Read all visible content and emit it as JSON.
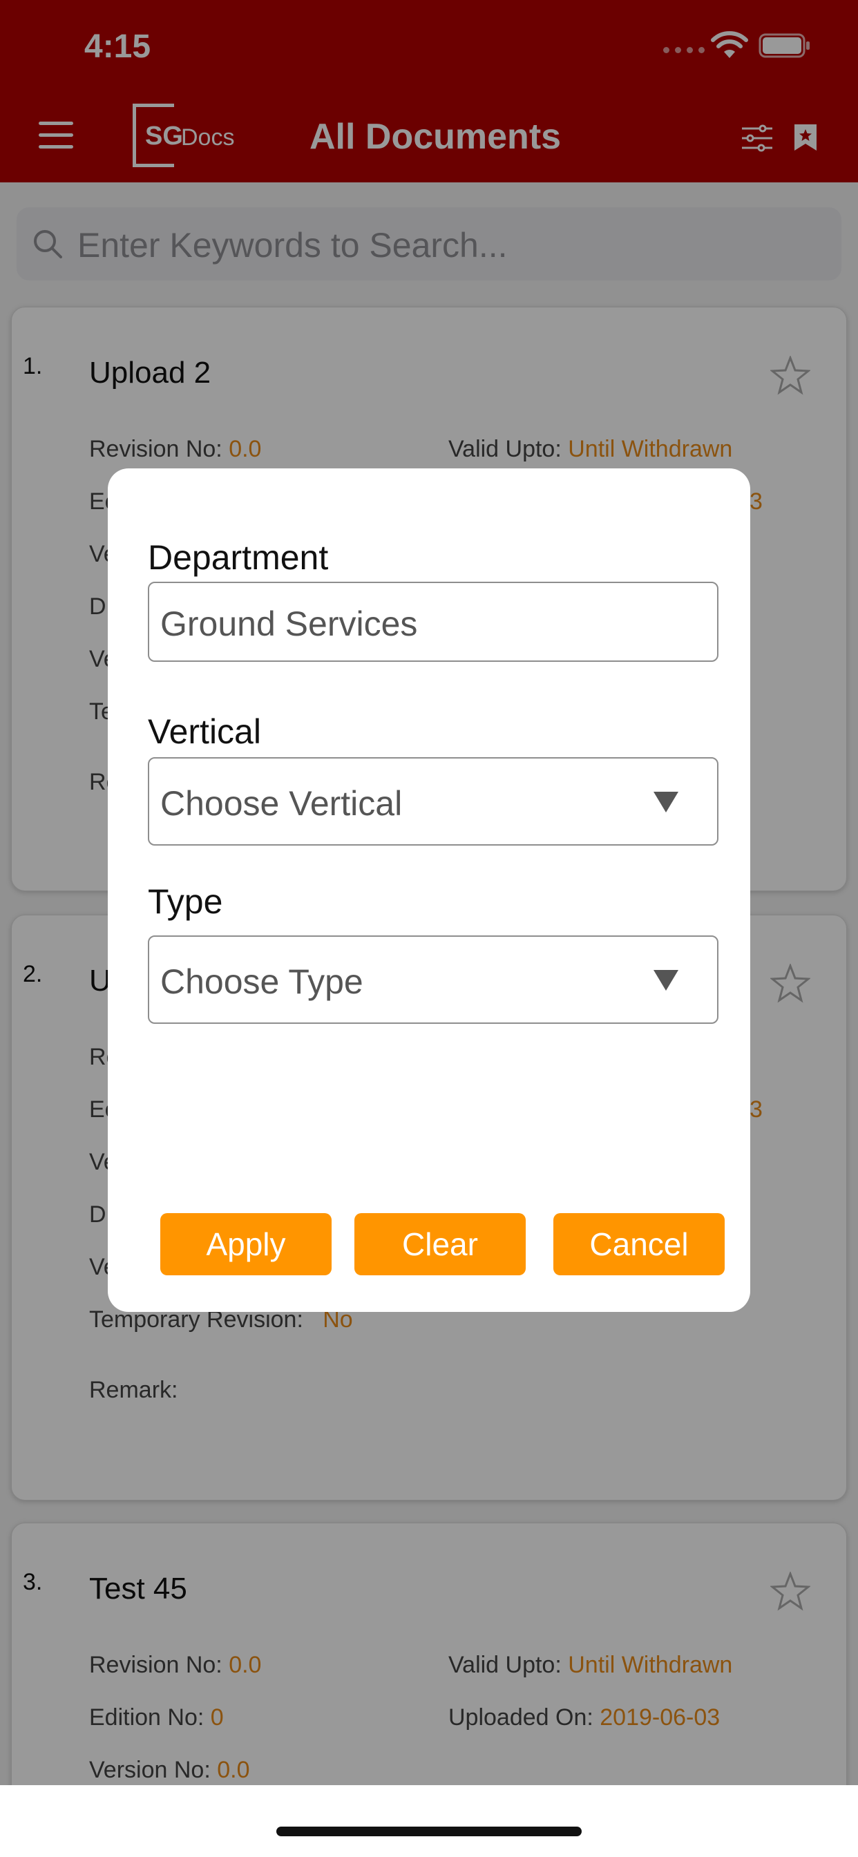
{
  "status_bar": {
    "time": "4:15"
  },
  "header": {
    "logo_mark": "SG",
    "logo_text": "Docs",
    "title": "All Documents"
  },
  "search": {
    "placeholder": "Enter Keywords to Search..."
  },
  "documents": [
    {
      "number": "1.",
      "title": "Upload 2",
      "revision_label": "Revision No:",
      "revision": "0.0",
      "valid_label": "Valid Upto:",
      "valid": "Until Withdrawn",
      "edition_partial": "Ec",
      "uploaded_partial": "3",
      "row3_partial": "Ve",
      "row4_partial": "D",
      "row5_partial": "Ve",
      "row6_partial": "Te",
      "remark_partial": "Re"
    },
    {
      "number": "2.",
      "title_partial": "U",
      "revision_partial": "Re",
      "edition_partial": "Ec",
      "uploaded_partial": "3",
      "row3_partial": "Ve",
      "row4_partial": "D",
      "row5_partial": "Ve",
      "temp_label": "Temporary Revision:",
      "temp": "No",
      "remark_label": "Remark:"
    },
    {
      "number": "3.",
      "title": "Test 45",
      "revision_label": "Revision No:",
      "revision": "0.0",
      "valid_label": "Valid Upto:",
      "valid": "Until Withdrawn",
      "edition_label": "Edition No:",
      "edition": "0",
      "uploaded_label": "Uploaded On:",
      "uploaded": "2019-06-03",
      "version_label": "Version No:",
      "version": "0.0"
    }
  ],
  "filter_dialog": {
    "department_label": "Department",
    "department_value": "Ground Services",
    "vertical_label": "Vertical",
    "vertical_value": "Choose Vertical",
    "type_label": "Type",
    "type_value": "Choose Type",
    "apply": "Apply",
    "clear": "Clear",
    "cancel": "Cancel"
  },
  "colors": {
    "header": "#b30000",
    "accent": "#ff9500",
    "value": "#e88a1a"
  },
  "icons": [
    "menu-icon",
    "filter-icon",
    "bookmark-icon",
    "search-icon",
    "star-icon",
    "wifi-icon",
    "battery-icon",
    "caret-down-icon"
  ]
}
